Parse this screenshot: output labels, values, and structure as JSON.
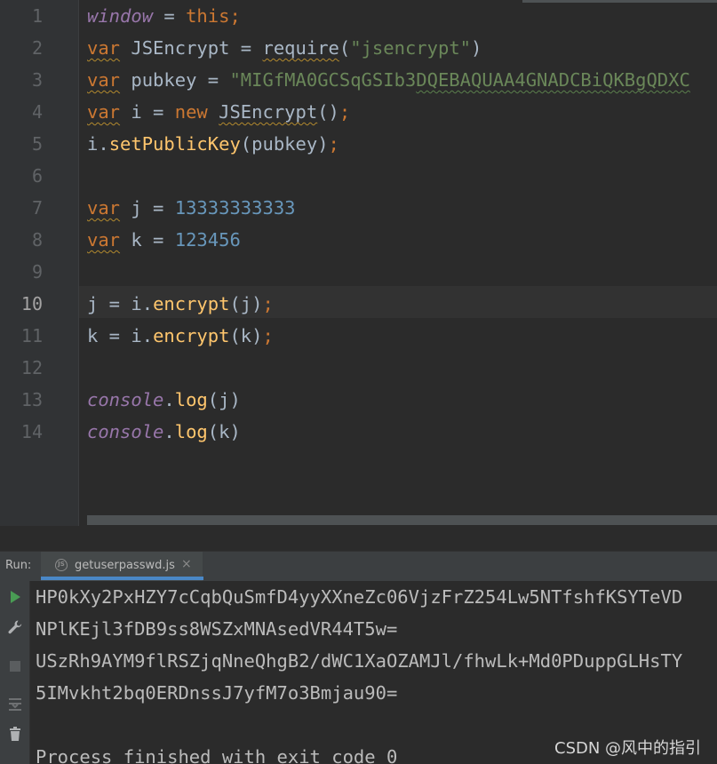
{
  "editor": {
    "line_numbers": [
      "1",
      "2",
      "3",
      "4",
      "5",
      "6",
      "7",
      "8",
      "9",
      "10",
      "11",
      "12",
      "13",
      "14"
    ],
    "current_line": "10",
    "code": {
      "l1": {
        "a": "window",
        "b": " = ",
        "c": "this",
        "d": ";"
      },
      "l2": {
        "a": "var",
        "b": " JSEncrypt = ",
        "c": "require",
        "d": "(",
        "e": "\"jsencrypt\"",
        "f": ")"
      },
      "l3": {
        "a": "var",
        "b": " pubkey = ",
        "c": "\"MIGfMA0GCSqGSIb3",
        "d": "DQEBAQUAA4GNADCBiQKBgQDXC"
      },
      "l4": {
        "a": "var",
        "b": " i = ",
        "c": "new",
        "d": " ",
        "e": "JSEncrypt",
        "f": "()",
        "g": ";"
      },
      "l5": {
        "a": "i.",
        "b": "setPublicKey",
        "c": "(pubkey)",
        "d": ";"
      },
      "l7": {
        "a": "var",
        "b": " j = ",
        "c": "13333333333"
      },
      "l8": {
        "a": "var",
        "b": " k = ",
        "c": "123456"
      },
      "l10": {
        "a": "j = i.",
        "b": "encrypt",
        "c": "(j)",
        "d": ";"
      },
      "l11": {
        "a": "k = i.",
        "b": "encrypt",
        "c": "(k)",
        "d": ";"
      },
      "l13": {
        "a": "console",
        "b": ".",
        "c": "log",
        "d": "(j)"
      },
      "l14": {
        "a": "console",
        "b": ".",
        "c": "log",
        "d": "(k)"
      }
    }
  },
  "run_panel": {
    "label": "Run:",
    "tab_icon_text": "JS",
    "tab_title": "getuserpasswd.js",
    "tab_close": "×",
    "toolbar": {
      "rerun_icon": "play-icon",
      "settings_icon": "wrench-icon",
      "stop_icon": "stop-icon",
      "scroll_icon": "scroll-to-end-icon",
      "trash_icon": "trash-icon"
    },
    "output": [
      "HP0kXy2PxHZY7cCqbQuSmfD4yyXXneZc06VjzFrZ254Lw5NTfshfKSYTeVD",
      "NPlKEjl3fDB9ss8WSZxMNAsedVR44T5w=",
      "USzRh9AYM9flRSZjqNneQhgB2/dWC1XaOZAMJl/fhwLk+Md0PDuppGLHsTY",
      "5IMvkht2bq0ERDnssJ7yfM7o3Bmjau90=",
      "",
      "Process finished with exit code 0"
    ]
  },
  "watermark": "CSDN @风中的指引",
  "colors": {
    "keyword": "#cc7832",
    "global": "#9876aa",
    "string": "#6a8759",
    "number": "#6897bb",
    "function": "#ffc66d",
    "text": "#a9b7c6",
    "run_tab_accent": "#4a88c7",
    "run_green": "#499c54"
  }
}
